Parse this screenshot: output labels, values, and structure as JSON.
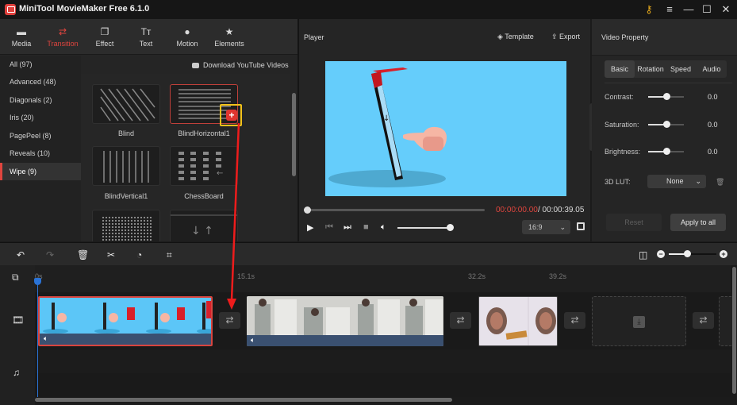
{
  "app": {
    "title": "MiniTool MovieMaker Free 6.1.0",
    "window_controls": [
      "key-icon",
      "menu-icon",
      "minimize-icon",
      "maximize-icon",
      "close-icon"
    ]
  },
  "toolbar": {
    "tabs": [
      {
        "label": "Media",
        "icon": "folder-icon"
      },
      {
        "label": "Transition",
        "icon": "transition-icon",
        "active": true
      },
      {
        "label": "Effect",
        "icon": "effect-icon"
      },
      {
        "label": "Text",
        "icon": "text-icon"
      },
      {
        "label": "Motion",
        "icon": "motion-icon"
      },
      {
        "label": "Elements",
        "icon": "elements-icon"
      }
    ]
  },
  "categories": [
    {
      "label": "All (97)"
    },
    {
      "label": "Advanced (48)"
    },
    {
      "label": "Diagonals (2)"
    },
    {
      "label": "Iris (20)"
    },
    {
      "label": "PagePeel (8)"
    },
    {
      "label": "Reveals (10)"
    },
    {
      "label": "Wipe (9)",
      "active": true
    }
  ],
  "download_link": "Download YouTube Videos",
  "transitions": [
    {
      "label": "Blind"
    },
    {
      "label": "BlindHorizontal1",
      "selected": true
    },
    {
      "label": "BlindVertical1"
    },
    {
      "label": "ChessBoard"
    },
    {
      "label": ""
    },
    {
      "label": ""
    }
  ],
  "add_button": "+",
  "player": {
    "title": "Player",
    "template_label": "Template",
    "export_label": "Export",
    "time_current": "00:00:00.00",
    "time_total": "/ 00:00:39.05",
    "progress": 0,
    "volume": 1.0,
    "aspect_ratio": "16:9"
  },
  "property": {
    "title": "Video Property",
    "tabs": [
      "Basic",
      "Rotation",
      "Speed",
      "Audio"
    ],
    "active_tab": "Basic",
    "rows": [
      {
        "label": "Contrast:",
        "value": "0.0"
      },
      {
        "label": "Saturation:",
        "value": "0.0"
      },
      {
        "label": "Brightness:",
        "value": "0.0"
      }
    ],
    "lut_label": "3D LUT:",
    "lut_value": "None",
    "reset_label": "Reset",
    "apply_label": "Apply to all"
  },
  "timeline": {
    "ruler": [
      "0s",
      "15.1s",
      "32.2s",
      "39.2s"
    ],
    "zoom_level": 0.38,
    "colors": {
      "accent": "#e0453e",
      "playhead": "#2a73d6",
      "highlight": "#f2c21a"
    }
  }
}
